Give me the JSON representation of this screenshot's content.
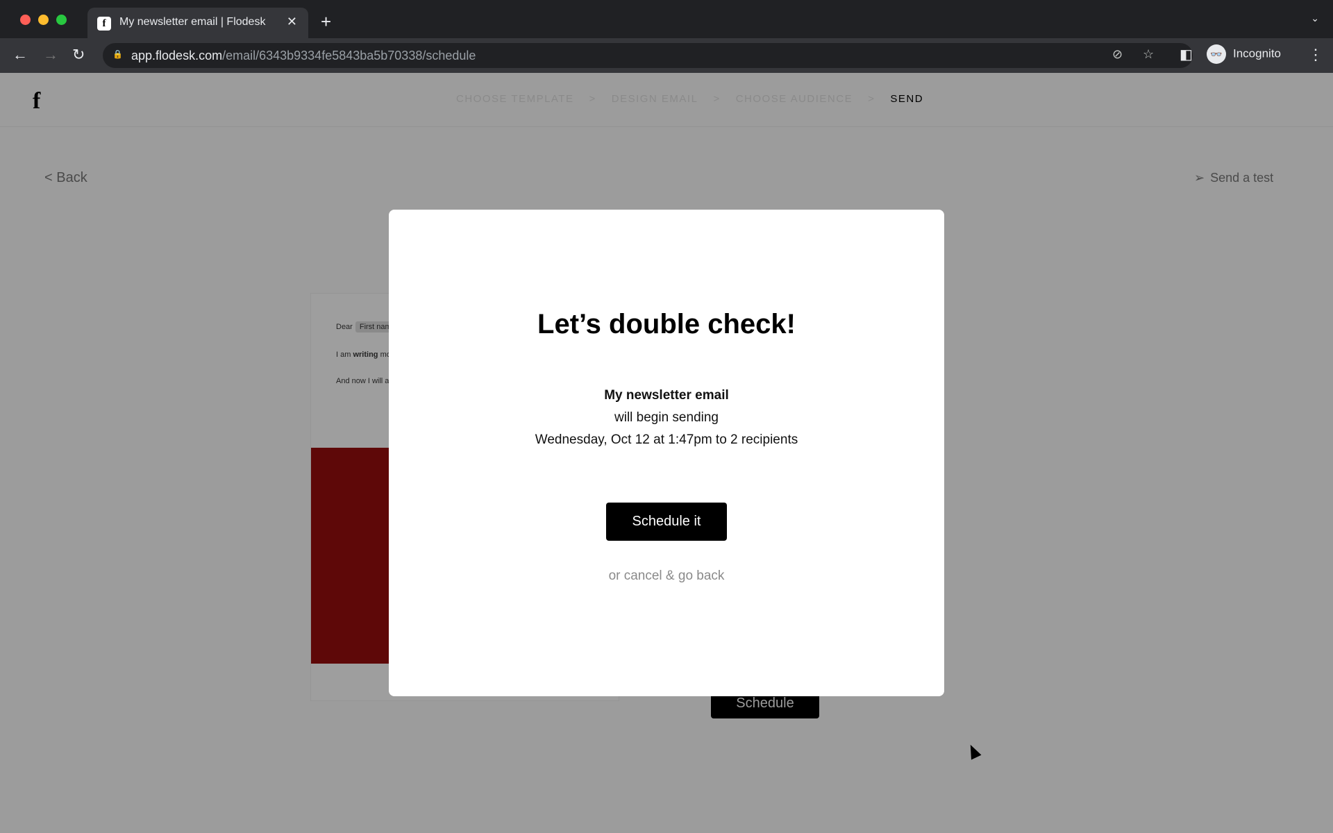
{
  "browser": {
    "tab_title": "My newsletter email | Flodesk",
    "url_host": "app.flodesk.com",
    "url_path": "/email/6343b9334fe5843ba5b70338/schedule",
    "profile": "Incognito"
  },
  "app": {
    "logo": "f",
    "steps": [
      "CHOOSE TEMPLATE",
      "DESIGN EMAIL",
      "CHOOSE AUDIENCE",
      "SEND"
    ],
    "step_separator": ">",
    "back": "< Back",
    "send_test": "Send a test",
    "schedule_bg": "Schedule"
  },
  "preview": {
    "line1_a": "Dear",
    "line1_chip": "First nam",
    "line2_a": "I am",
    "line2_b": "writing",
    "line2_c": "mo",
    "line3": "And now I will at",
    "accent": "#5e0808"
  },
  "modal": {
    "title": "Let’s double check!",
    "email_name": "My newsletter email",
    "line2": "will begin sending",
    "line3": "Wednesday, Oct 12 at 1:47pm to 2 recipients",
    "primary": "Schedule it",
    "cancel": "or cancel & go back"
  }
}
